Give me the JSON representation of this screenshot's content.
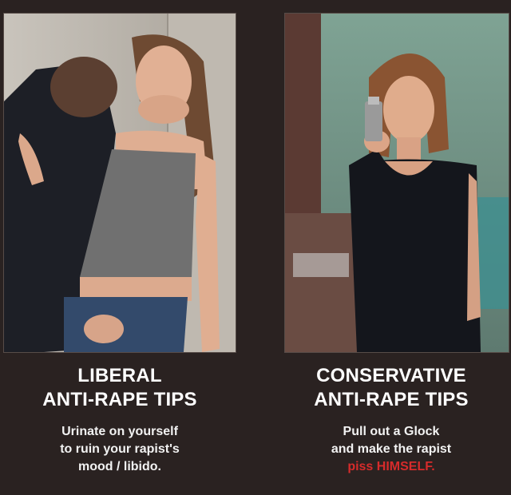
{
  "left": {
    "title_line1": "LIBERAL",
    "title_line2": "ANTI-RAPE TIPS",
    "body_line1": "Urinate on yourself",
    "body_line2": "to ruin your rapist's",
    "body_line3": "mood / libido."
  },
  "right": {
    "title_line1": "CONSERVATIVE",
    "title_line2": "ANTI-RAPE TIPS",
    "body_line1": "Pull out a Glock",
    "body_line2": "and make the rapist",
    "body_line3_accent": "piss HIMSELF."
  },
  "colors": {
    "background": "#2a2221",
    "text": "#ffffff",
    "accent": "#d62b2b"
  }
}
